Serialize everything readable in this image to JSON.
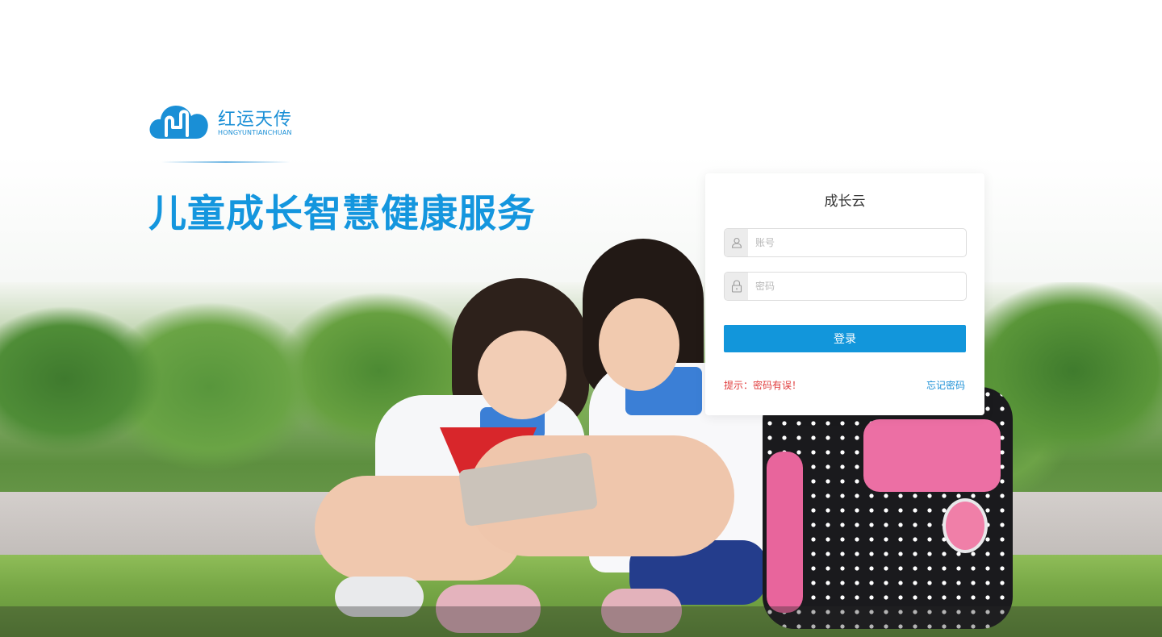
{
  "brand": {
    "name": "红运天传",
    "name_latin": "HONGYUNTIANCHUAN",
    "headline": "儿童成长智慧健康服务",
    "color": "#1496de"
  },
  "login": {
    "title": "成长云",
    "account_placeholder": "账号",
    "password_placeholder": "密码",
    "account_icon": "user-icon",
    "password_icon": "lock-icon",
    "submit_label": "登录",
    "submit_color": "#1296db",
    "hint_text": "提示：密码有误！",
    "hint_color": "#e03c3c",
    "forgot_label": "忘记密码"
  }
}
